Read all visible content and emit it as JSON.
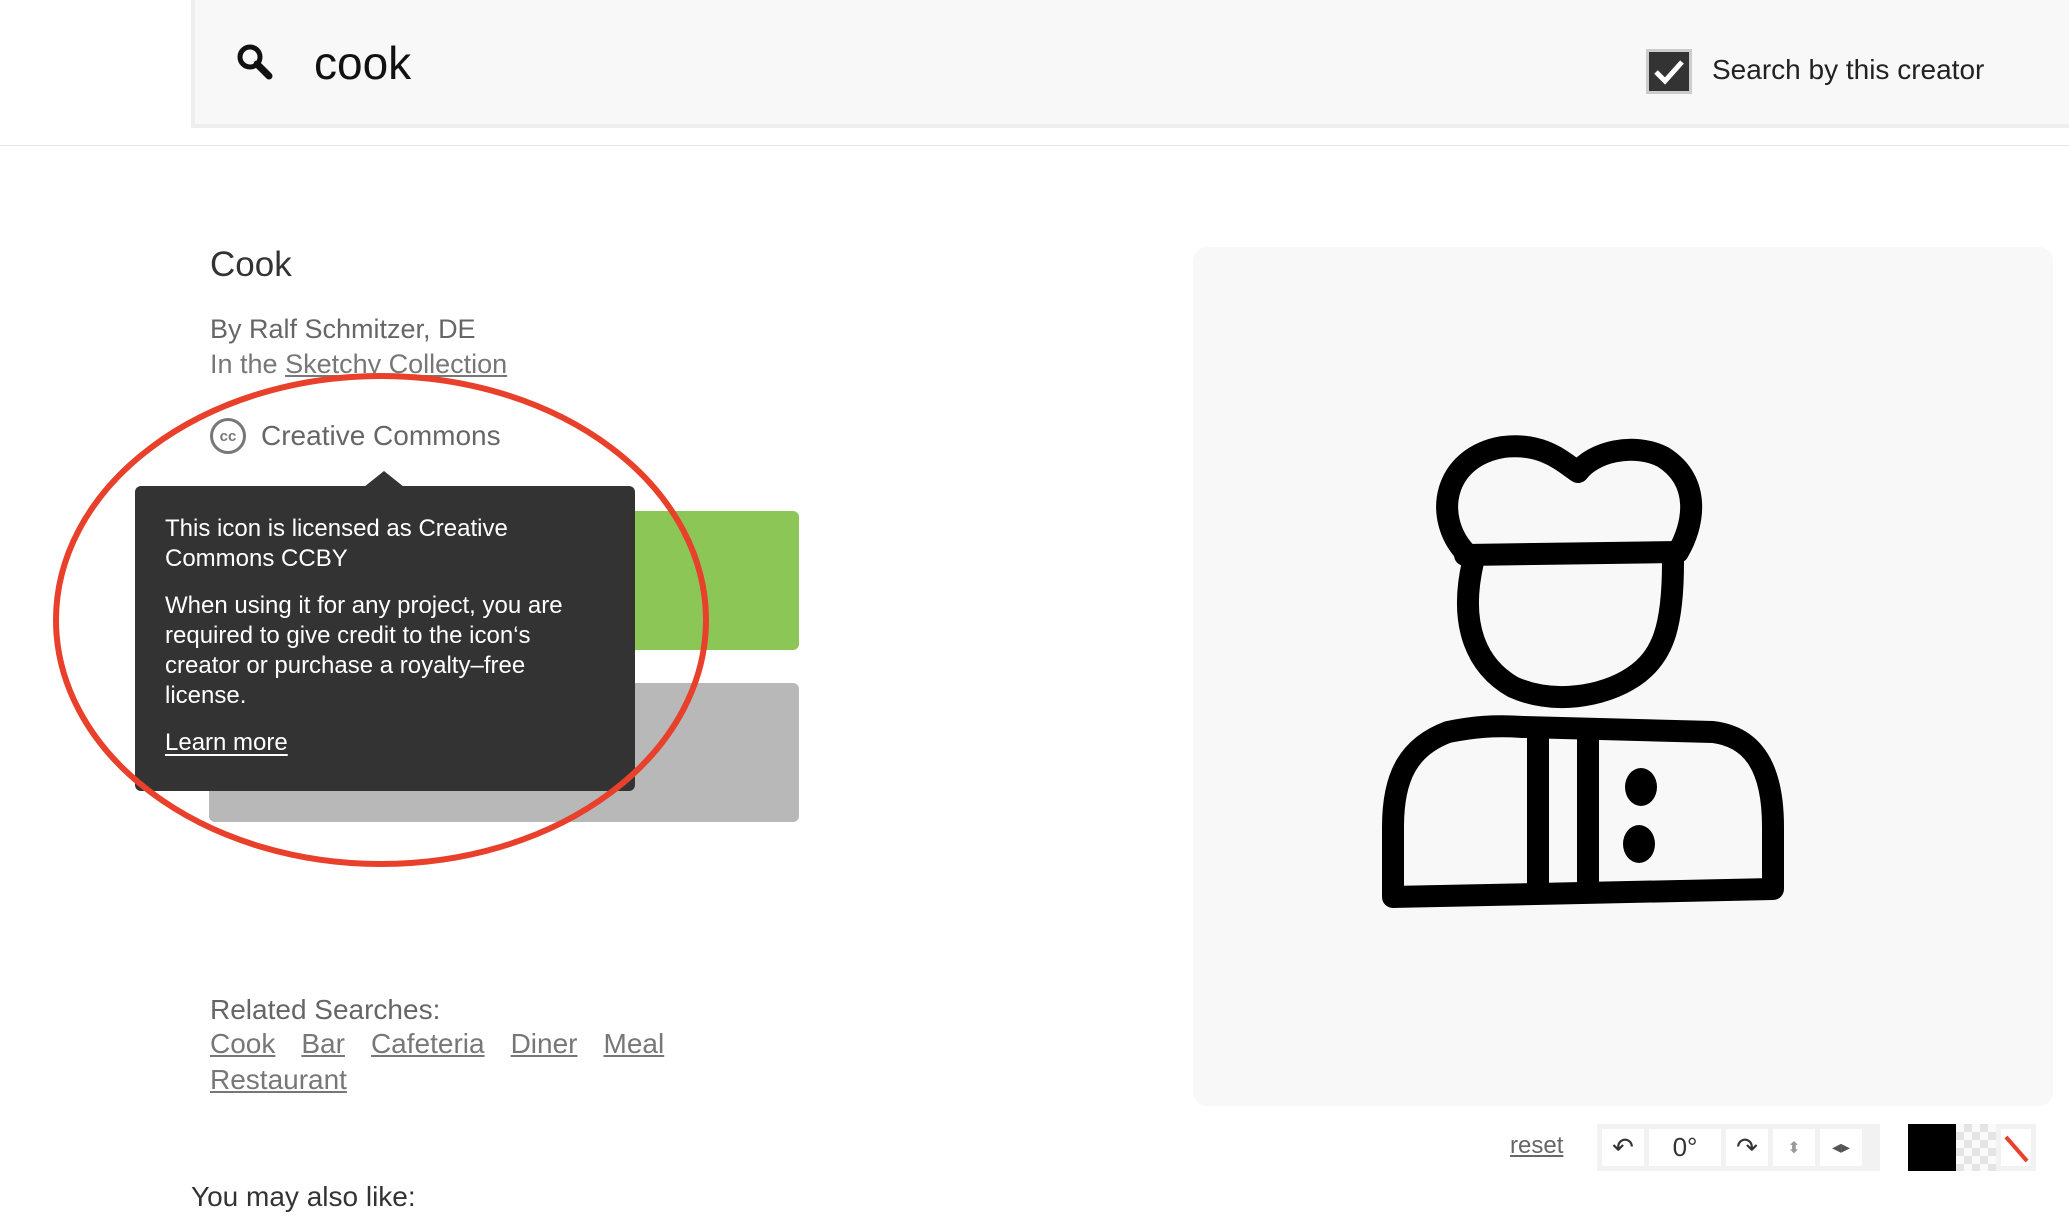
{
  "search": {
    "query": "cook",
    "icon": "search-icon",
    "creator_filter_label": "Search by this creator",
    "creator_filter_checked": true
  },
  "icon": {
    "title": "Cook",
    "author": "By Ralf Schmitzer, DE",
    "collection_prefix": "In the",
    "collection_name": "Sketchy Collection",
    "license_label": "Creative Commons"
  },
  "tooltip": {
    "line1": "This icon is licensed as Creative Commons CCBY",
    "line2": "When using it for any project, you are required to give credit to the icon‘s creator or purchase a royalty–free license.",
    "link": "Learn more"
  },
  "related": {
    "title": "Related Searches:",
    "links": [
      "Cook",
      "Bar",
      "Cafeteria",
      "Diner",
      "Meal",
      "Restaurant"
    ]
  },
  "editor": {
    "reset": "reset",
    "rotation": "0°",
    "colors": {
      "selected": "#000000",
      "annotation": "#e8402a"
    }
  },
  "also_like": "You may also like:"
}
